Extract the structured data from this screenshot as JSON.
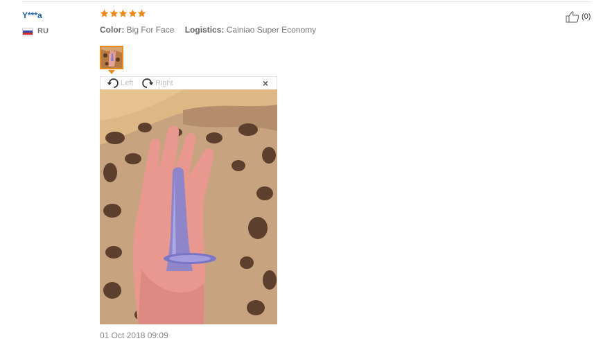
{
  "review": {
    "user_name": "Y***a",
    "country_code": "RU",
    "rating": 5,
    "attributes": [
      {
        "label": "Color:",
        "value": "Big For Face"
      },
      {
        "label": "Logistics:",
        "value": "Cainiao Super Economy"
      }
    ],
    "like_count": "(0)",
    "date": "01 Oct 2018 09:09"
  },
  "viewer": {
    "rotate_left_label": "Left",
    "rotate_right_label": "Right",
    "close_symbol": "×"
  },
  "icons": {
    "star": "star-icon",
    "like": "thumbs-up-icon",
    "rotate_left": "rotate-left-icon",
    "rotate_right": "rotate-right-icon",
    "close": "close-icon",
    "flag": "russia-flag-icon"
  },
  "colors": {
    "user_name": "#1a62b8",
    "star": "#ef8a13",
    "thumb_border": "#ef8a13",
    "muted_text": "#777777"
  }
}
